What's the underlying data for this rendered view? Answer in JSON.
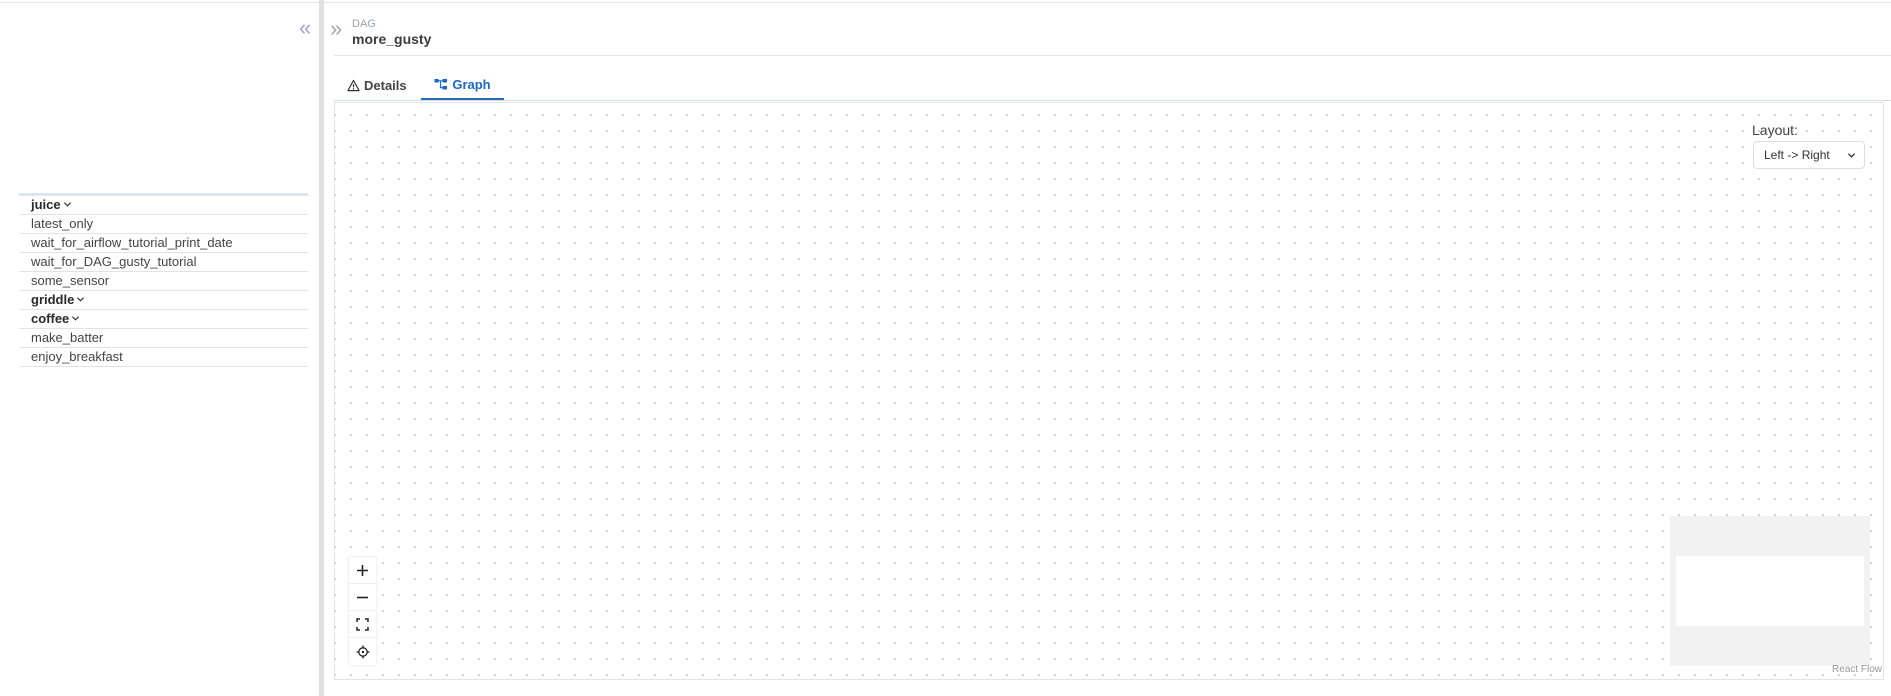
{
  "sidebar": {
    "collapse_icon": "double-chevron-left-icon",
    "tasks": [
      {
        "label": "juice",
        "group": true
      },
      {
        "label": "latest_only",
        "group": false
      },
      {
        "label": "wait_for_airflow_tutorial_print_date",
        "group": false
      },
      {
        "label": "wait_for_DAG_gusty_tutorial",
        "group": false
      },
      {
        "label": "some_sensor",
        "group": false
      },
      {
        "label": "griddle",
        "group": true
      },
      {
        "label": "coffee",
        "group": true
      },
      {
        "label": "make_batter",
        "group": false
      },
      {
        "label": "enjoy_breakfast",
        "group": false
      }
    ]
  },
  "header": {
    "expand_icon": "double-chevron-right-icon",
    "breadcrumb_label": "DAG",
    "title": "more_gusty"
  },
  "tabs": [
    {
      "label": "Details",
      "icon": "warning-icon",
      "active": false
    },
    {
      "label": "Graph",
      "icon": "graph-icon",
      "active": true
    }
  ],
  "graph": {
    "layout_label": "Layout:",
    "layout_value": "Left -> Right",
    "controls": [
      "zoom-in-icon",
      "zoom-out-icon",
      "fit-view-icon",
      "center-icon"
    ],
    "attribution": "React Flow"
  },
  "colors": {
    "accent": "#2b6cb0",
    "active_tab_text": "#1a68c7",
    "canvas_dots": "#c8c8c8",
    "minimap_bg": "#f2f2f2"
  }
}
